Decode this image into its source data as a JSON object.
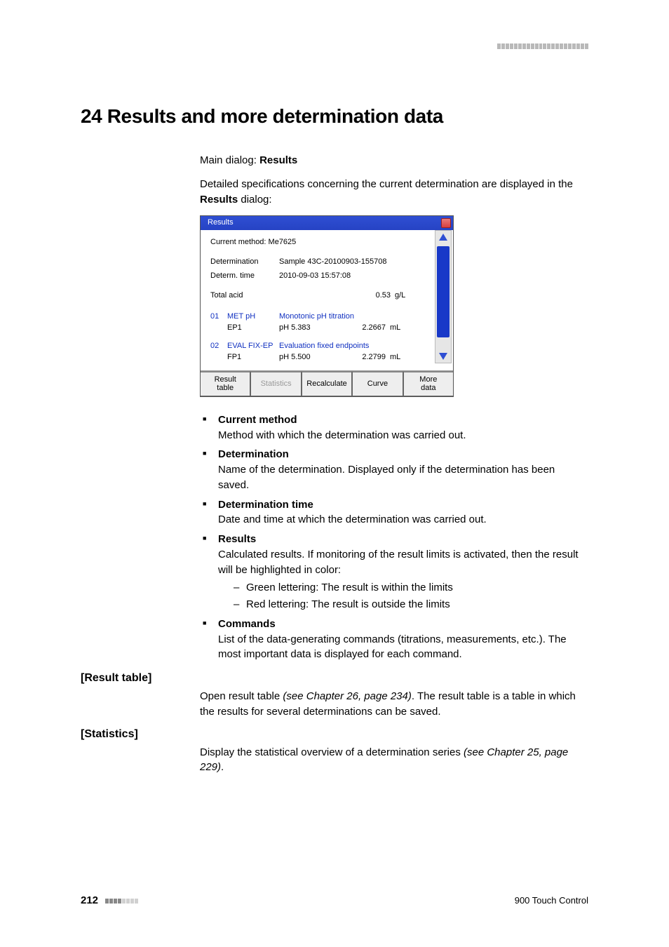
{
  "chapter": {
    "title": "24 Results and more determination data"
  },
  "intro": {
    "prefix": "Main dialog: ",
    "dialog_name": "Results",
    "para1a": "Detailed specifications concerning the current determination are displayed in the ",
    "para1b": "Results",
    "para1c": " dialog:"
  },
  "dialog": {
    "title": "Results",
    "current_method_label": "Current method: Me7625",
    "rows": {
      "determination": {
        "label": "Determination",
        "value": "Sample 43C-20100903-155708"
      },
      "determ_time": {
        "label": "Determ. time",
        "value": "2010-09-03 15:57:08"
      }
    },
    "result": {
      "label": "Total acid",
      "value": "0.53",
      "unit": "g/L"
    },
    "commands": [
      {
        "idx": "01",
        "name": "MET pH",
        "desc": "Monotonic pH titration",
        "sub": {
          "c1": "EP1",
          "c2": "pH 5.383",
          "c3": "2.2667",
          "c4": "mL"
        }
      },
      {
        "idx": "02",
        "name": "EVAL FIX-EP",
        "desc": "Evaluation fixed endpoints",
        "sub": {
          "c1": "FP1",
          "c2": "pH 5.500",
          "c3": "2.2799",
          "c4": "mL"
        }
      }
    ],
    "buttons": {
      "result_table": "Result\ntable",
      "statistics": "Statistics",
      "recalculate": "Recalculate",
      "curve": "Curve",
      "more_data": "More\ndata"
    }
  },
  "bullets": {
    "b1": {
      "h": "Current method",
      "t": "Method with which the determination was carried out."
    },
    "b2": {
      "h": "Determination",
      "t": "Name of the determination. Displayed only if the determination has been saved."
    },
    "b3": {
      "h": "Determination time",
      "t": "Date and time at which the determination was carried out."
    },
    "b4": {
      "h": "Results",
      "t": "Calculated results. If monitoring of the result limits is activated, then the result will be highlighted in color:",
      "d1": "Green lettering: The result is within the limits",
      "d2": "Red lettering: The result is outside the limits"
    },
    "b5": {
      "h": "Commands",
      "t": "List of the data-generating commands (titrations, measurements, etc.). The most important data is displayed for each command."
    }
  },
  "sections": {
    "result_table": {
      "label": "[Result table]",
      "t1": "Open result table ",
      "t2": "(see Chapter 26, page 234)",
      "t3": ". The result table is a table in which the results for several determinations can be saved."
    },
    "statistics": {
      "label": "[Statistics]",
      "t1": "Display the statistical overview of a determination series ",
      "t2": "(see Chapter 25, page 229)",
      "t3": "."
    }
  },
  "footer": {
    "page": "212",
    "product": "900 Touch Control"
  }
}
